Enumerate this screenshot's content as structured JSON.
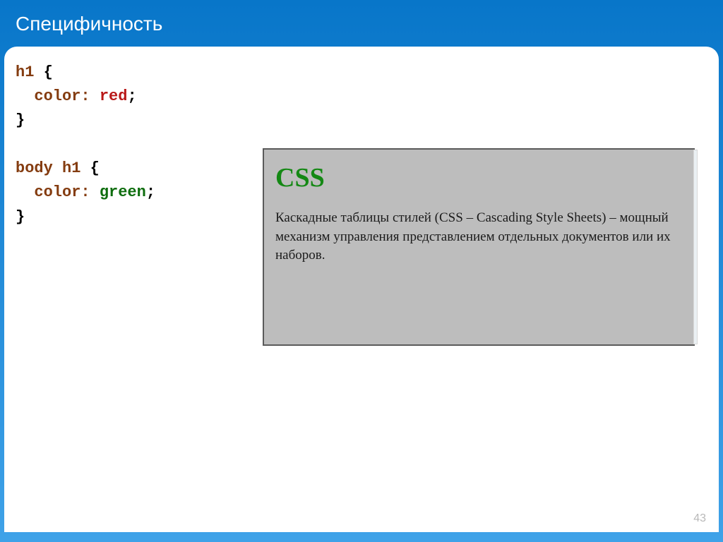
{
  "slide": {
    "title": "Специфичность",
    "page_number": "43"
  },
  "code": {
    "rule1": {
      "selector": "h1",
      "open": " {",
      "prop": "  color:",
      "val": " red",
      "semi": ";",
      "close": "}"
    },
    "rule2": {
      "selector": "body h1",
      "open": " {",
      "prop": "  color:",
      "val": " green",
      "semi": ";",
      "close": "}"
    }
  },
  "render": {
    "heading": "CSS",
    "paragraph": "Каскадные таблицы стилей (CSS – Cascading Style Sheets) – мощный механизм управления представлением отдельных документов или их наборов."
  }
}
